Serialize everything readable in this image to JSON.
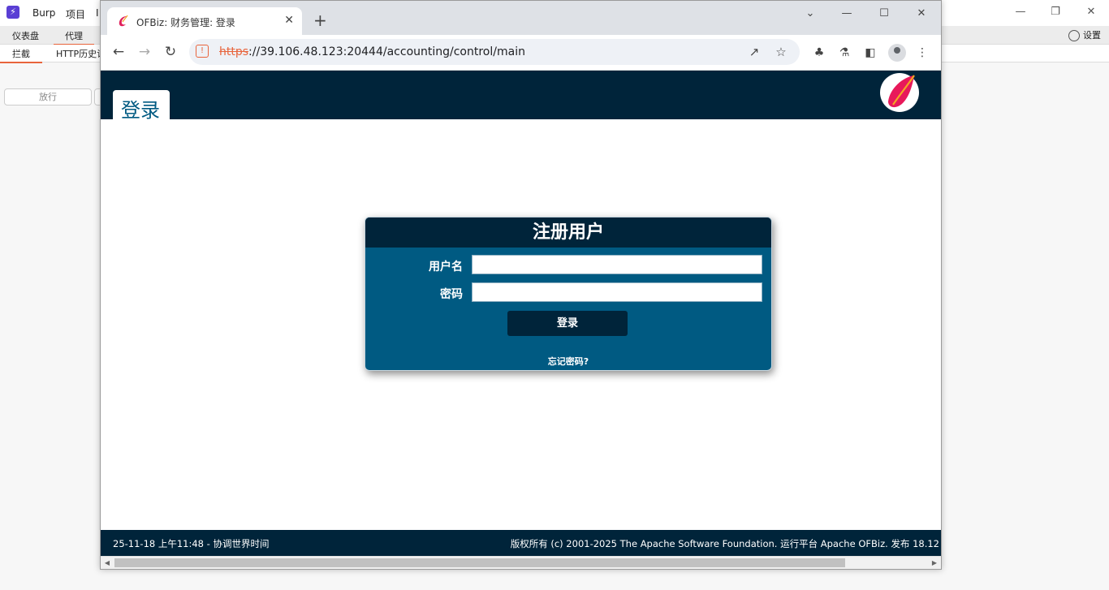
{
  "burp": {
    "app_name": "Burp",
    "menu": [
      "Burp",
      "项目",
      "I"
    ],
    "tabs": [
      {
        "label": "仪表盘",
        "active": false
      },
      {
        "label": "代理",
        "active": true
      }
    ],
    "settings_label": "设置",
    "subtabs": [
      {
        "label": "拦截",
        "active": true
      },
      {
        "label": "HTTP历史记",
        "active": false
      }
    ],
    "forward_label": "放行",
    "accent_color": "#e8643c"
  },
  "browser": {
    "tab": {
      "title": "OFBiz: 财务管理: 登录",
      "close_icon": "close-icon"
    },
    "new_tab_icon": "plus-icon",
    "url": {
      "scheme": "https",
      "rest": "://39.106.48.123:20444/accounting/control/main"
    }
  },
  "page": {
    "title": "登录",
    "header_color": "#00243a",
    "login": {
      "heading": "注册用户",
      "username_label": "用户名",
      "password_label": "密码",
      "username_value": "",
      "password_value": "",
      "submit_label": "登录",
      "forgot_password": "忘记密码?",
      "panel_color": "#005a82"
    },
    "footer": {
      "left": "25-11-18 上午11:48 - 协调世界时间",
      "right": "版权所有 (c) 2001-2025 The Apache Software Foundation. 运行平台 Apache OFBiz. 发布 18.12"
    }
  }
}
